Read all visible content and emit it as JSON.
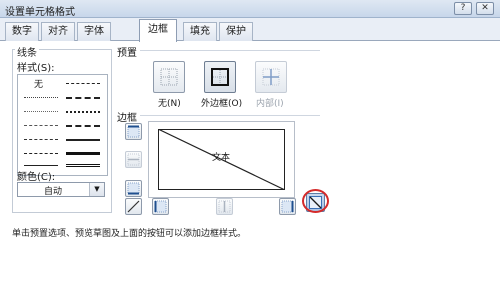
{
  "window": {
    "title": "设置单元格格式",
    "help_glyph": "?",
    "close_glyph": "✕"
  },
  "tabs": [
    {
      "label": "数字",
      "active": false
    },
    {
      "label": "对齐",
      "active": false
    },
    {
      "label": "字体",
      "active": false
    },
    {
      "label": "边框",
      "active": true
    },
    {
      "label": "填充",
      "active": false
    },
    {
      "label": "保护",
      "active": false
    }
  ],
  "line_group": {
    "title": "线条",
    "style_label": "样式(S):",
    "none_label": "无",
    "color_label": "颜色(C):",
    "color_value": "自动",
    "dropdown_glyph": "▼"
  },
  "presets": {
    "title": "预置",
    "items": [
      {
        "label": "无(N)",
        "icon": "border-none-icon",
        "enabled": true
      },
      {
        "label": "外边框(O)",
        "icon": "border-outline-icon",
        "enabled": true
      },
      {
        "label": "内部(I)",
        "icon": "border-inside-icon",
        "enabled": false
      }
    ]
  },
  "border": {
    "title": "边框",
    "preview_text": "文本",
    "buttons": [
      {
        "name": "border-top-button",
        "icon": "border-top-icon",
        "enabled": true
      },
      {
        "name": "border-inside-horizontal-button",
        "icon": "border-inside-horizontal-icon",
        "enabled": false
      },
      {
        "name": "border-bottom-button",
        "icon": "border-bottom-icon",
        "enabled": true
      },
      {
        "name": "diagonal-up-button",
        "icon": "diagonal-up-icon",
        "enabled": true
      },
      {
        "name": "border-left-button",
        "icon": "border-left-icon",
        "enabled": true
      },
      {
        "name": "border-inside-vertical-button",
        "icon": "border-inside-vertical-icon",
        "enabled": false
      },
      {
        "name": "border-right-button",
        "icon": "border-right-icon",
        "enabled": true
      },
      {
        "name": "diagonal-down-button",
        "icon": "diagonal-down-icon",
        "enabled": true,
        "pressed": true
      }
    ]
  },
  "hint": "单击预置选项、预览草图及上面的按钮可以添加边框样式。",
  "colors": {
    "highlight_circle": "#d42a2a",
    "accent": "#3a6fb5"
  }
}
